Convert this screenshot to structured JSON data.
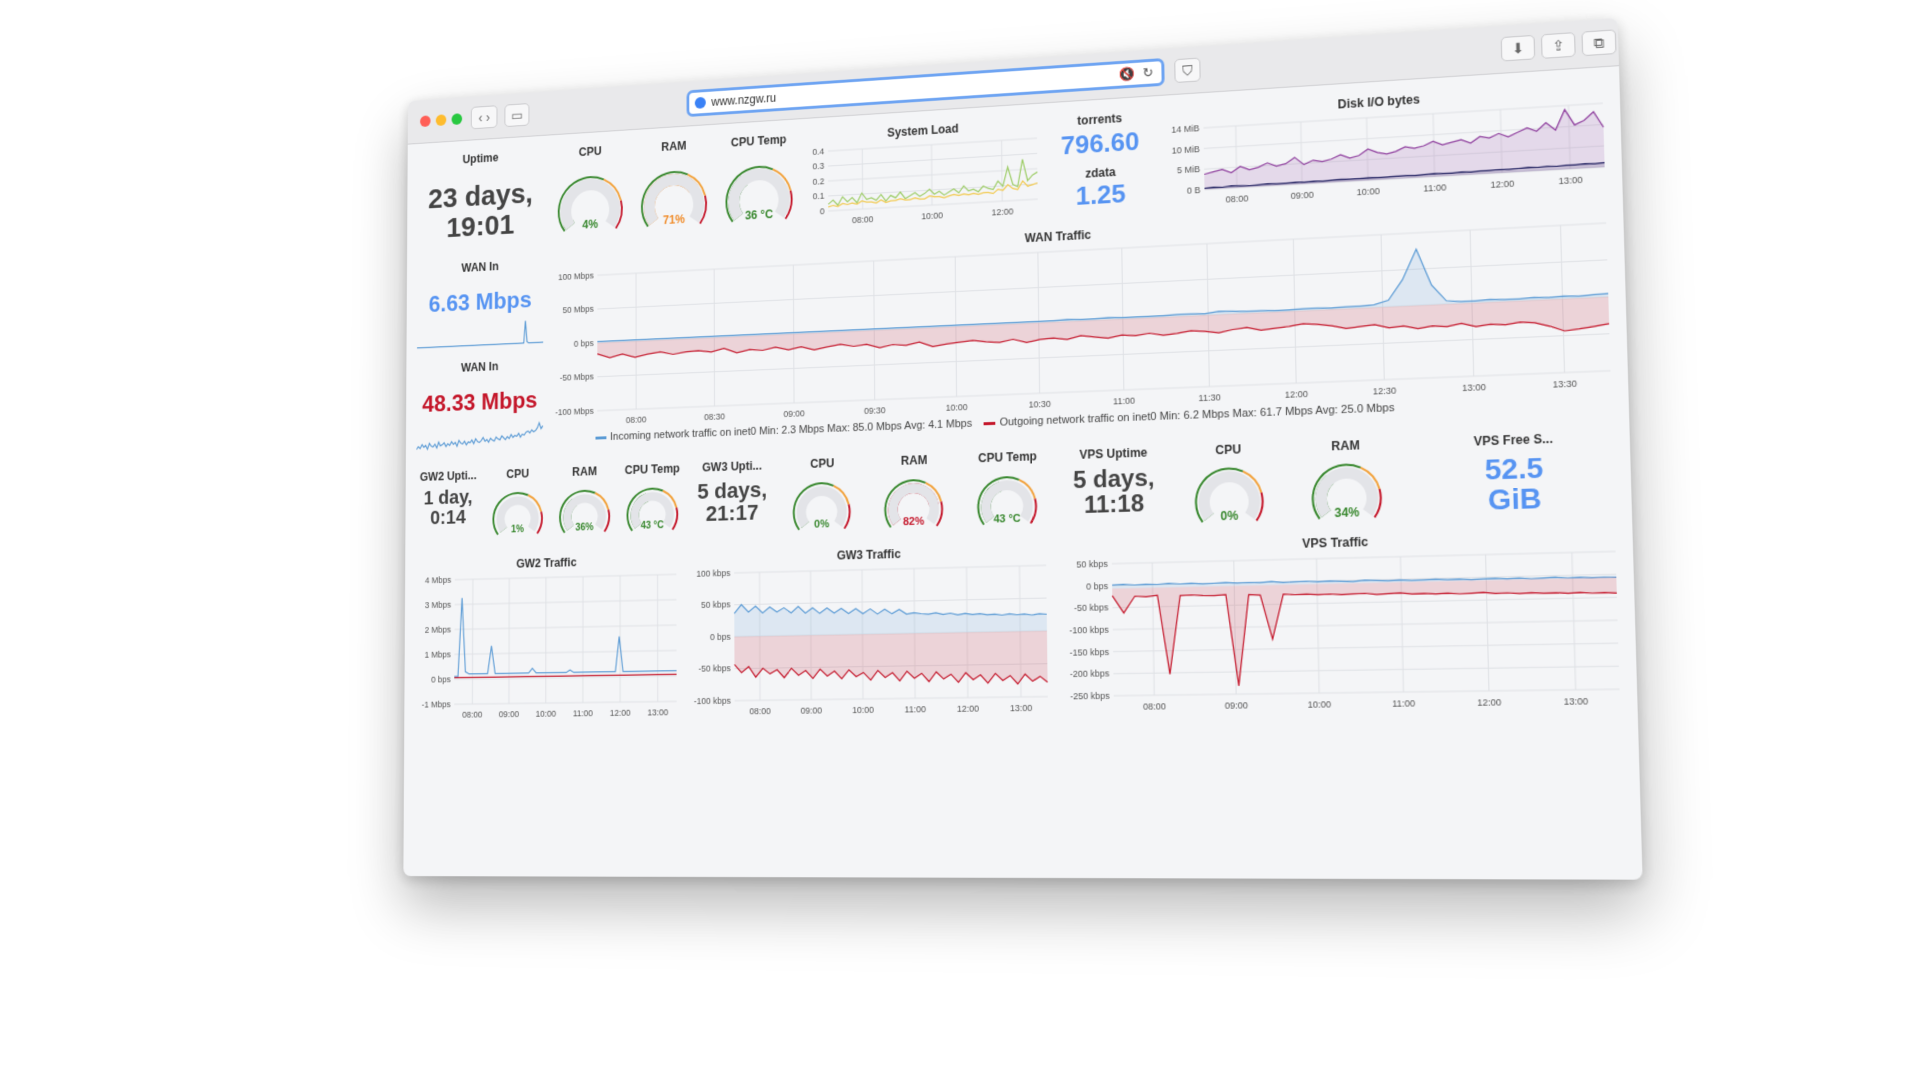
{
  "browser": {
    "url": "www.nzgw.ru"
  },
  "colors": {
    "blue": "#5b9bd5",
    "red": "#c4162a",
    "green": "#37872d",
    "orange": "#f08c2a",
    "purple": "#8f3f9e",
    "lightgreen": "#9ccc65",
    "bigblue": "#5794f2"
  },
  "main": {
    "uptime": {
      "title": "Uptime",
      "value_line1": "23 days,",
      "value_line2": "19:01"
    },
    "cpu": {
      "title": "CPU",
      "value": "4%",
      "pct": 4
    },
    "ram": {
      "title": "RAM",
      "value": "71%",
      "pct": 71
    },
    "cpu_temp": {
      "title": "CPU Temp",
      "value": "36 °C",
      "pct": 36
    },
    "system_load": {
      "title": "System Load"
    },
    "torrents": {
      "title": "torrents",
      "value": "796.60"
    },
    "zdata": {
      "title": "zdata",
      "value": "1.25"
    },
    "disk_io": {
      "title": "Disk I/O bytes"
    },
    "wan_in_1": {
      "title": "WAN In",
      "value": "6.63 Mbps"
    },
    "wan_in_2": {
      "title": "WAN In",
      "value": "48.33 Mbps"
    },
    "wan_traffic": {
      "title": "WAN Traffic",
      "legend_in": "Incoming network traffic on inet0  Min: 2.3 Mbps  Max: 85.0 Mbps  Avg: 4.1 Mbps",
      "legend_out": "Outgoing network traffic on inet0  Min: 6.2 Mbps  Max: 61.7 Mbps  Avg: 25.0 Mbps"
    }
  },
  "gw2": {
    "uptime": {
      "title": "GW2 Upti...",
      "value_line1": "1 day,",
      "value_line2": "0:14"
    },
    "cpu": {
      "title": "CPU",
      "value": "1%",
      "pct": 1
    },
    "ram": {
      "title": "RAM",
      "value": "36%",
      "pct": 36
    },
    "cpu_temp": {
      "title": "CPU Temp",
      "value": "43 °C",
      "pct": 43
    },
    "traffic": {
      "title": "GW2 Traffic"
    }
  },
  "gw3": {
    "uptime": {
      "title": "GW3 Upti...",
      "value_line1": "5 days,",
      "value_line2": "21:17"
    },
    "cpu": {
      "title": "CPU",
      "value": "0%",
      "pct": 0
    },
    "ram": {
      "title": "RAM",
      "value": "82%",
      "pct": 82
    },
    "cpu_temp": {
      "title": "CPU Temp",
      "value": "43 °C",
      "pct": 43
    },
    "traffic": {
      "title": "GW3 Traffic"
    }
  },
  "vps": {
    "uptime": {
      "title": "VPS Uptime",
      "value_line1": "5 days,",
      "value_line2": "11:18"
    },
    "cpu": {
      "title": "CPU",
      "value": "0%",
      "pct": 0
    },
    "ram": {
      "title": "RAM",
      "value": "34%",
      "pct": 34
    },
    "free": {
      "title": "VPS Free S...",
      "value_line1": "52.5",
      "value_line2": "GiB"
    },
    "traffic": {
      "title": "VPS Traffic"
    }
  },
  "chart_data": [
    {
      "id": "system_load",
      "type": "line",
      "title": "System Load",
      "x_ticks": [
        "08:00",
        "10:00",
        "12:00"
      ],
      "y_ticks": [
        "0.4",
        "0.3",
        "0.2",
        "0.1",
        "0"
      ],
      "ylim": [
        0,
        0.45
      ],
      "series": [
        {
          "color": "#9ccc65",
          "values": [
            0.05,
            0.08,
            0.04,
            0.1,
            0.06,
            0.09,
            0.05,
            0.12,
            0.07,
            0.08,
            0.06,
            0.1,
            0.05,
            0.09,
            0.07,
            0.11,
            0.06,
            0.08,
            0.1,
            0.07,
            0.09,
            0.12,
            0.08,
            0.1,
            0.07,
            0.09,
            0.11,
            0.08,
            0.13,
            0.09,
            0.1,
            0.08,
            0.12,
            0.1,
            0.09,
            0.15,
            0.11,
            0.25,
            0.12,
            0.1,
            0.3,
            0.14,
            0.18,
            0.2
          ]
        },
        {
          "color": "#f2c94c",
          "values": [
            0.03,
            0.04,
            0.03,
            0.05,
            0.04,
            0.05,
            0.04,
            0.06,
            0.05,
            0.05,
            0.04,
            0.06,
            0.04,
            0.05,
            0.05,
            0.06,
            0.05,
            0.05,
            0.06,
            0.05,
            0.05,
            0.07,
            0.06,
            0.06,
            0.05,
            0.06,
            0.07,
            0.06,
            0.07,
            0.06,
            0.07,
            0.06,
            0.07,
            0.07,
            0.06,
            0.09,
            0.08,
            0.12,
            0.09,
            0.08,
            0.14,
            0.1,
            0.11,
            0.12
          ]
        }
      ]
    },
    {
      "id": "disk_io",
      "type": "line",
      "title": "Disk I/O bytes",
      "x_ticks": [
        "08:00",
        "09:00",
        "10:00",
        "11:00",
        "12:00",
        "13:00"
      ],
      "y_ticks": [
        "14 MiB",
        "10 MiB",
        "5 MiB",
        "0 B"
      ],
      "ylim": [
        0,
        16
      ],
      "series": [
        {
          "color": "#8f3f9e",
          "values": [
            4,
            4.5,
            5,
            4,
            5.5,
            4.5,
            5,
            6,
            5,
            5.5,
            7,
            5,
            6,
            5.5,
            6,
            7,
            6,
            6.5,
            8,
            7,
            6.5,
            7,
            8,
            7.5,
            8,
            9,
            8,
            8.5,
            9,
            8,
            9.5,
            9,
            10,
            9,
            10,
            11,
            10,
            12,
            10,
            15,
            11,
            12,
            14,
            10
          ]
        },
        {
          "color": "#1f1f5f",
          "values": [
            0.4,
            0.5,
            0.4,
            0.6,
            0.5,
            0.4,
            0.5,
            0.6,
            0.5,
            0.5,
            0.6,
            0.5,
            0.6,
            0.5,
            0.6,
            0.7,
            0.6,
            0.6,
            0.7,
            0.6,
            0.6,
            0.7,
            0.7,
            0.6,
            0.7,
            0.8,
            0.7,
            0.7,
            0.8,
            0.7,
            0.8,
            0.8,
            0.9,
            0.8,
            0.9,
            1.0,
            0.9,
            1.0,
            0.9,
            1.0,
            1.0,
            1.1,
            1.0,
            1.1
          ]
        }
      ]
    },
    {
      "id": "wan_traffic",
      "type": "area",
      "title": "WAN Traffic",
      "x_ticks": [
        "08:00",
        "08:30",
        "09:00",
        "09:30",
        "10:00",
        "10:30",
        "11:00",
        "11:30",
        "12:00",
        "12:30",
        "13:00",
        "13:30"
      ],
      "y_ticks": [
        "100 Mbps",
        "50 Mbps",
        "0 bps",
        "-50 Mbps",
        "-100 Mbps"
      ],
      "ylim": [
        -110,
        110
      ],
      "series": [
        {
          "name": "Incoming network traffic on inet0",
          "color": "#5b9bd5",
          "values": [
            2,
            2,
            2,
            2,
            2,
            2,
            2,
            2,
            2,
            2,
            2,
            2,
            2,
            2,
            2,
            2,
            2,
            2,
            2,
            2,
            2,
            2,
            2,
            2,
            2,
            2,
            2,
            2,
            2,
            2,
            2,
            2,
            2,
            2,
            2,
            2,
            3,
            2,
            2,
            3,
            2,
            2,
            2,
            2,
            3,
            3,
            2,
            5,
            4,
            3,
            3,
            2,
            2,
            3,
            3,
            2,
            3,
            3,
            4,
            10,
            40,
            85,
            30,
            5,
            3,
            3,
            4,
            3,
            3,
            4,
            3,
            4,
            3,
            4,
            5
          ]
        },
        {
          "name": "Outgoing network traffic on inet0",
          "color": "#c4162a",
          "values": [
            -18,
            -25,
            -20,
            -26,
            -22,
            -19,
            -24,
            -21,
            -20,
            -23,
            -18,
            -26,
            -22,
            -24,
            -20,
            -25,
            -21,
            -27,
            -23,
            -20,
            -24,
            -22,
            -28,
            -24,
            -26,
            -22,
            -30,
            -27,
            -25,
            -23,
            -26,
            -28,
            -24,
            -30,
            -26,
            -25,
            -28,
            -23,
            -26,
            -29,
            -25,
            -27,
            -24,
            -28,
            -26,
            -23,
            -25,
            -28,
            -24,
            -22,
            -27,
            -25,
            -23,
            -20,
            -22,
            -25,
            -30,
            -28,
            -26,
            -32,
            -30,
            -35,
            -32,
            -34,
            -30,
            -36,
            -33,
            -35,
            -32,
            -34,
            -40,
            -48,
            -46,
            -43,
            -40
          ]
        }
      ]
    },
    {
      "id": "wan_in_1_spark",
      "type": "line",
      "series": [
        {
          "color": "#5b9bd5",
          "values": [
            2,
            2,
            2,
            2,
            2,
            2,
            2,
            2,
            2,
            2,
            2,
            2,
            2,
            2,
            2,
            2,
            2,
            2,
            2,
            2,
            2,
            2,
            2,
            2,
            2,
            2,
            2,
            2,
            2,
            2,
            2,
            2,
            2,
            2,
            2,
            2,
            2,
            2,
            2,
            2,
            2,
            2,
            2,
            2,
            2,
            2,
            2,
            2,
            2,
            2,
            2,
            2,
            2,
            2,
            2,
            2,
            2,
            2,
            2,
            2,
            2,
            2,
            2,
            2,
            2,
            2,
            2,
            2,
            20,
            3,
            2,
            2,
            2,
            2,
            2,
            2,
            2,
            2,
            2,
            2
          ]
        }
      ]
    },
    {
      "id": "wan_in_2_spark",
      "type": "line",
      "series": [
        {
          "color": "#5b9bd5",
          "values": [
            15,
            18,
            16,
            20,
            17,
            19,
            15,
            21,
            18,
            17,
            20,
            16,
            22,
            18,
            19,
            21,
            17,
            20,
            18,
            22,
            19,
            21,
            17,
            23,
            20,
            19,
            22,
            18,
            21,
            20,
            23,
            19,
            24,
            21,
            20,
            22,
            25,
            21,
            23,
            20,
            24,
            22,
            21,
            25,
            23,
            22,
            26,
            24,
            22,
            25,
            23,
            27,
            24,
            26,
            25,
            28,
            24,
            27,
            26,
            29,
            30,
            28,
            31,
            29,
            30,
            33,
            38,
            32,
            35
          ]
        }
      ]
    },
    {
      "id": "gw2_traffic",
      "type": "line",
      "title": "GW2 Traffic",
      "x_ticks": [
        "08:00",
        "09:00",
        "10:00",
        "11:00",
        "12:00",
        "13:00"
      ],
      "y_ticks": [
        "4 Mbps",
        "3 Mbps",
        "2 Mbps",
        "1 Mbps",
        "0 bps",
        "-1 Mbps"
      ],
      "ylim": [
        -1.2,
        4.2
      ],
      "series": [
        {
          "color": "#5b9bd5",
          "values": [
            0,
            0,
            3.4,
            0.2,
            0.1,
            0.1,
            0.1,
            0.1,
            0.1,
            0.1,
            1.3,
            0.1,
            0.1,
            0.1,
            0.1,
            0.1,
            0.1,
            0.1,
            0.1,
            0.1,
            0.1,
            0.3,
            0.1,
            0.1,
            0.1,
            0.1,
            0.1,
            0.1,
            0.1,
            0.1,
            0.1,
            0.2,
            0.1,
            0.1,
            0.1,
            0.1,
            0.1,
            0.1,
            0.1,
            0.1,
            0.1,
            0.1,
            0.1,
            0.1,
            1.6,
            0.1,
            0.1,
            0.1,
            0.1,
            0.1,
            0.1,
            0.1,
            0.1,
            0.1,
            0.1,
            0.1,
            0.1,
            0.1,
            0.1,
            0.1
          ]
        },
        {
          "color": "#c4162a",
          "values": [
            -0.05,
            -0.05,
            -0.05,
            -0.05,
            -0.05,
            -0.05,
            -0.05,
            -0.05,
            -0.05,
            -0.05,
            -0.05,
            -0.05,
            -0.05,
            -0.05,
            -0.05,
            -0.05,
            -0.05,
            -0.05,
            -0.05,
            -0.05,
            -0.05,
            -0.05,
            -0.05,
            -0.05,
            -0.05,
            -0.05,
            -0.05,
            -0.05,
            -0.05,
            -0.05,
            -0.05,
            -0.05,
            -0.05,
            -0.05,
            -0.05,
            -0.05,
            -0.05,
            -0.05,
            -0.05,
            -0.05,
            -0.05,
            -0.05,
            -0.05,
            -0.05,
            -0.05,
            -0.05,
            -0.05,
            -0.05,
            -0.05,
            -0.05,
            -0.05,
            -0.05,
            -0.05,
            -0.05,
            -0.05,
            -0.05,
            -0.05,
            -0.05,
            -0.05,
            -0.05
          ]
        }
      ]
    },
    {
      "id": "gw3_traffic",
      "type": "area",
      "title": "GW3 Traffic",
      "x_ticks": [
        "08:00",
        "09:00",
        "10:00",
        "11:00",
        "12:00",
        "13:00"
      ],
      "y_ticks": [
        "100 kbps",
        "50 kbps",
        "0 bps",
        "-50 kbps",
        "-100 kbps"
      ],
      "ylim": [
        -110,
        110
      ],
      "series": [
        {
          "color": "#5b9bd5",
          "values": [
            40,
            55,
            42,
            52,
            40,
            50,
            41,
            48,
            39,
            50,
            38,
            47,
            37,
            46,
            37,
            45,
            36,
            44,
            35,
            43,
            34,
            42,
            34,
            41,
            33,
            35,
            33,
            32,
            34,
            31,
            33,
            30,
            32,
            30,
            31,
            29,
            30,
            28,
            30,
            28,
            29,
            27,
            29,
            28
          ]
        },
        {
          "color": "#c4162a",
          "values": [
            -48,
            -62,
            -52,
            -70,
            -55,
            -65,
            -58,
            -72,
            -56,
            -68,
            -60,
            -74,
            -58,
            -70,
            -62,
            -75,
            -60,
            -72,
            -65,
            -78,
            -62,
            -74,
            -66,
            -80,
            -64,
            -76,
            -68,
            -82,
            -66,
            -78,
            -70,
            -84,
            -68,
            -80,
            -72,
            -86,
            -70,
            -82,
            -74,
            -88,
            -72,
            -84,
            -76,
            -86
          ]
        }
      ]
    },
    {
      "id": "vps_traffic",
      "type": "area",
      "title": "VPS Traffic",
      "x_ticks": [
        "08:00",
        "09:00",
        "10:00",
        "11:00",
        "12:00",
        "13:00"
      ],
      "y_ticks": [
        "50 kbps",
        "0 bps",
        "-50 kbps",
        "-100 kbps",
        "-150 kbps",
        "-200 kbps",
        "-250 kbps"
      ],
      "ylim": [
        -260,
        60
      ],
      "series": [
        {
          "color": "#5b9bd5",
          "values": [
            8,
            9,
            7,
            8,
            7,
            9,
            7,
            8,
            6,
            7,
            8,
            6,
            7,
            6,
            8,
            5,
            6,
            7,
            5,
            6,
            5,
            4,
            6,
            5,
            4,
            5,
            3,
            4,
            5,
            3,
            4,
            2,
            3,
            4,
            2,
            3,
            1,
            2,
            3,
            1,
            2,
            0,
            1,
            0
          ]
        },
        {
          "color": "#c4162a",
          "values": [
            -18,
            -60,
            -20,
            -22,
            -19,
            -210,
            -21,
            -20,
            -22,
            -23,
            -21,
            -240,
            -22,
            -24,
            -130,
            -23,
            -25,
            -24,
            -26,
            -25,
            -27,
            -26,
            -25,
            -28,
            -27,
            -26,
            -29,
            -28,
            -30,
            -29,
            -31,
            -30,
            -29,
            -32,
            -31,
            -33,
            -32,
            -34,
            -33,
            -35,
            -34,
            -36,
            -35,
            -37
          ]
        }
      ]
    }
  ]
}
